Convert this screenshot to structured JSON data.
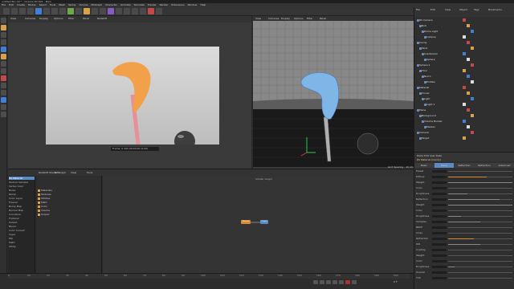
{
  "window": {
    "title": "untitled 60.c4d * - Cinema 4D R21 - Main"
  },
  "menu": [
    "File",
    "Edit",
    "Create",
    "Modes",
    "Select",
    "Tools",
    "Mesh",
    "Spline",
    "Volume",
    "MoGraph",
    "Character",
    "Animate",
    "Simulate",
    "Tracker",
    "Render",
    "Extensions",
    "Window",
    "Help"
  ],
  "viewport_render": {
    "header_items": [
      "View",
      "Cameras",
      "Display",
      "Options",
      "Filter",
      "Panel",
      "Redshift"
    ],
    "status": "Frame: 0 200 00:00:00 (0.00)"
  },
  "viewport_perspective": {
    "header_items": [
      "View",
      "Cameras",
      "Display",
      "Options",
      "Filter",
      "Panel"
    ],
    "info": "Grid Spacing : 10 cm"
  },
  "object_manager": {
    "header_items": [
      "File",
      "Edit",
      "View",
      "Object",
      "Tags",
      "Bookmarks"
    ],
    "rows": [
      "RS Camera",
      "Null",
      "Dome Light",
      "Lollipop",
      "Candy",
      "Stick",
      "Subdivision",
      "Sphere",
      "Sphere.1",
      "Floor",
      "Null.1",
      "Emitter",
      "Material",
      "Cloner",
      "Light",
      "Light.1",
      "Plane",
      "Background",
      "Volume Builder",
      "Mesher",
      "Camera",
      "Target"
    ]
  },
  "attributes": {
    "header": "Mode  Edit  User Data",
    "title": "RS Material [Candy]",
    "tabs": [
      "Basic",
      "Base",
      "Reflection",
      "Refraction",
      "Advanced"
    ],
    "rows": [
      {
        "label": "Preset",
        "level": 0.0
      },
      {
        "label": "Diffuse",
        "level": 0.6
      },
      {
        "label": "Weight",
        "level": 1.0
      },
      {
        "label": "Color",
        "level": 0.0
      },
      {
        "label": "Roughness",
        "level": 0.3
      },
      {
        "label": "Reflection",
        "level": 0.8
      },
      {
        "label": "Weight",
        "level": 1.0
      },
      {
        "label": "Color",
        "level": 0.0
      },
      {
        "label": "Roughness",
        "level": 0.2
      },
      {
        "label": "Samples",
        "level": 0.5
      },
      {
        "label": "BRDF",
        "level": 0.0
      },
      {
        "label": "Aniso",
        "level": 0.0
      },
      {
        "label": "Refraction",
        "level": 0.4
      },
      {
        "label": "IOR",
        "level": 0.5
      },
      {
        "label": "Coating",
        "level": 0.0
      },
      {
        "label": "Weight",
        "level": 0.0
      },
      {
        "label": "Color",
        "level": 0.0
      },
      {
        "label": "Roughness",
        "level": 0.1
      },
      {
        "label": "Overall",
        "level": 0.0
      },
      {
        "label": "Tint",
        "level": 0.0
      }
    ]
  },
  "shader_graph": {
    "header_items": [
      "Redshift Shader Graph",
      "Edit",
      "View",
      "Tools"
    ],
    "title": "Shader Graph",
    "left_items": [
      "RS Material",
      "Texture Sampler",
      "Vertex Color",
      "Noise",
      "Ramp",
      "Color Layer",
      "Fresnel",
      "Bump Map",
      "Normal Map",
      "Curvature",
      "Triplanar",
      "Output",
      "Blend",
      "Color Correct",
      "Layer",
      "Mix",
      "Math",
      "Utility"
    ],
    "mid_items": [
      "Materials",
      "Textures",
      "Utilities",
      "Math",
      "Color",
      "Volume",
      "Output"
    ],
    "nodes": [
      "Material",
      "Output"
    ]
  },
  "timeline": {
    "ticks": [
      "0",
      "10",
      "20",
      "30",
      "40",
      "50",
      "60",
      "70",
      "80",
      "90",
      "100",
      "110",
      "120",
      "130",
      "140",
      "150",
      "160",
      "170",
      "180",
      "190",
      "200"
    ],
    "current": "0 F"
  },
  "colors": {
    "accent": "#5a8bc4",
    "candy": "#f2a04a",
    "stick": "#e8909a",
    "wire": "#7fb6e8"
  }
}
